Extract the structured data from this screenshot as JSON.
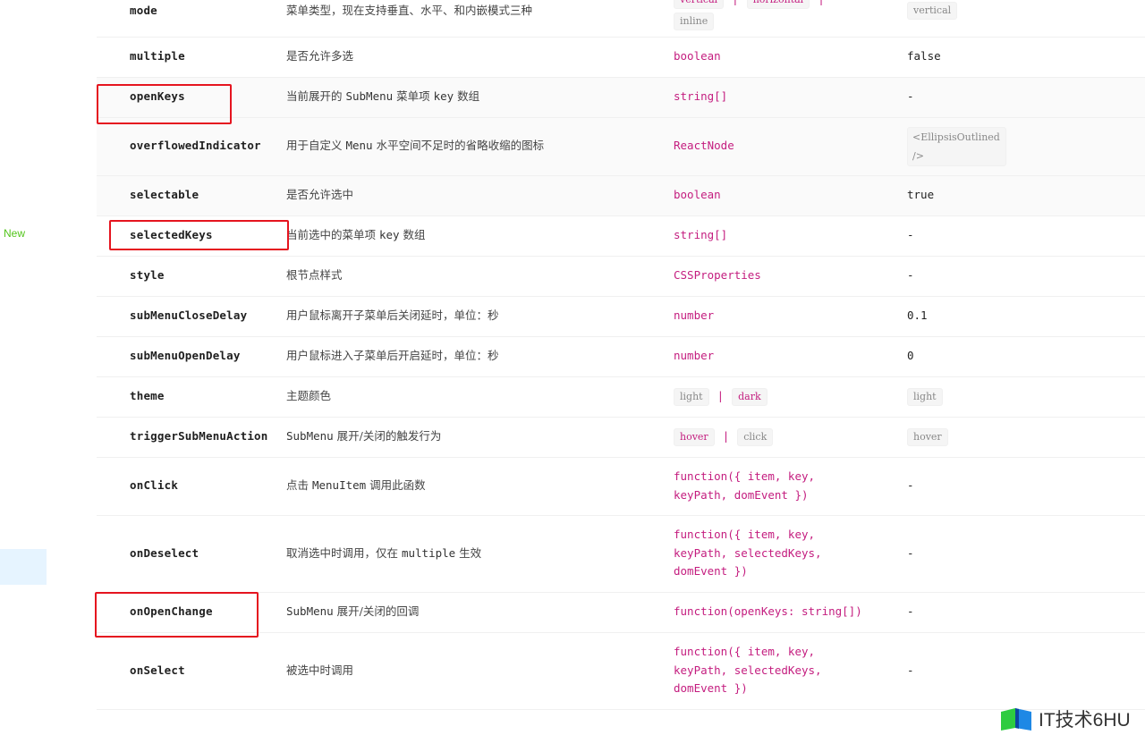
{
  "sidebar": {
    "new_badge": "New"
  },
  "rows": [
    {
      "prop": "mode",
      "desc": "菜单类型，现在支持垂直、水平、和内嵌模式三种",
      "type_tags": [
        "vertical",
        "horizontal",
        "inline"
      ],
      "default_tag": "vertical",
      "height": 58
    },
    {
      "prop": "multiple",
      "desc": "是否允许多选",
      "type": "boolean",
      "default": "false",
      "height": 45
    },
    {
      "prop": "openKeys",
      "desc_parts": [
        "当前展开的 ",
        "SubMenu",
        " 菜单项 ",
        "key",
        " 数组"
      ],
      "type": "string[]",
      "default": "-",
      "height": 45
    },
    {
      "prop": "overflowedIndicator",
      "desc_parts": [
        "用于自定义 ",
        "Menu",
        " 水平空间不足时的省略收缩的图标"
      ],
      "type": "ReactNode",
      "default_tag_multiline": [
        "<EllipsisOutlined",
        "/>"
      ],
      "height": 65
    },
    {
      "prop": "selectable",
      "desc": "是否允许选中",
      "type": "boolean",
      "default": "true",
      "height": 45
    },
    {
      "prop": "selectedKeys",
      "desc_parts": [
        "当前选中的菜单项 ",
        "key",
        " 数组"
      ],
      "type": "string[]",
      "default": "-",
      "height": 45
    },
    {
      "prop": "style",
      "desc": "根节点样式",
      "type": "CSSProperties",
      "default": "-",
      "height": 45
    },
    {
      "prop": "subMenuCloseDelay",
      "desc": "用户鼠标离开子菜单后关闭延时，单位：秒",
      "type": "number",
      "default": "0.1",
      "height": 45
    },
    {
      "prop": "subMenuOpenDelay",
      "desc": "用户鼠标进入子菜单后开启延时，单位：秒",
      "type": "number",
      "default": "0",
      "height": 45
    },
    {
      "prop": "theme",
      "desc": "主题颜色",
      "type_tags": [
        "light",
        "dark"
      ],
      "default_tag": "light",
      "height": 45
    },
    {
      "prop": "triggerSubMenuAction",
      "desc_parts": [
        "SubMenu",
        " 展开/关闭的触发行为"
      ],
      "type_tags": [
        "hover",
        "click"
      ],
      "default_tag": "hover",
      "height": 45
    },
    {
      "prop": "onClick",
      "desc_parts": [
        "点击 ",
        "MenuItem",
        " 调用此函数"
      ],
      "type_lines": [
        "function({ item, key,",
        "keyPath, domEvent })"
      ],
      "default": "-",
      "height": 65
    },
    {
      "prop": "onDeselect",
      "desc_parts": [
        "取消选中时调用，仅在 ",
        "multiple",
        " 生效"
      ],
      "type_lines": [
        "function({ item, key,",
        "keyPath, selectedKeys,",
        "domEvent })"
      ],
      "default": "-",
      "height": 86
    },
    {
      "prop": "onOpenChange",
      "desc_parts": [
        "SubMenu",
        " 展开/关闭的回调"
      ],
      "type": "function(openKeys: string[])",
      "default": "-",
      "height": 45
    },
    {
      "prop": "onSelect",
      "desc": "被选中时调用",
      "type_lines": [
        "function({ item, key,",
        "keyPath, selectedKeys,",
        "domEvent })"
      ],
      "default": "-",
      "height": 86
    }
  ],
  "watermark": {
    "text": "IT技术6HU"
  }
}
